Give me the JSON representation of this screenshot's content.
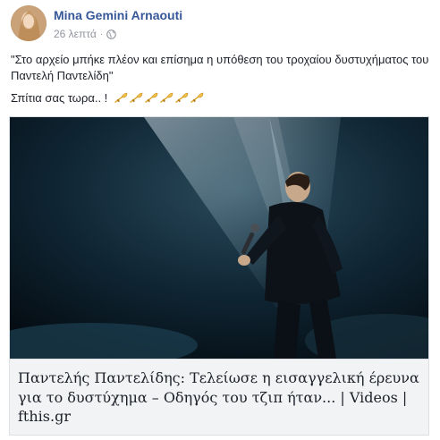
{
  "post": {
    "author": "Mina Gemini Arnaouti",
    "time": "26 λεπτά",
    "separator": "·",
    "quote": "\"Στο αρχείο μπήκε πλέον και επίσημα η υπόθεση του τροχαίου δυστυχήματος του Παντελή Παντελίδη\"",
    "line2": "Σπίτια σας τωρα.. !",
    "emoji_name": "trumpet-icon",
    "emoji_count": 6
  },
  "link_card": {
    "title": "Παντελής Παντελίδης: Τελείωσε η εισαγγελική έρευνα για το δυστύχημα – Οδηγός του τζιπ ήταν... | Videos |",
    "domain": "fthis.gr"
  },
  "colors": {
    "author": "#365899",
    "meta": "#90949c",
    "caption_bg": "#f2f3f5"
  }
}
